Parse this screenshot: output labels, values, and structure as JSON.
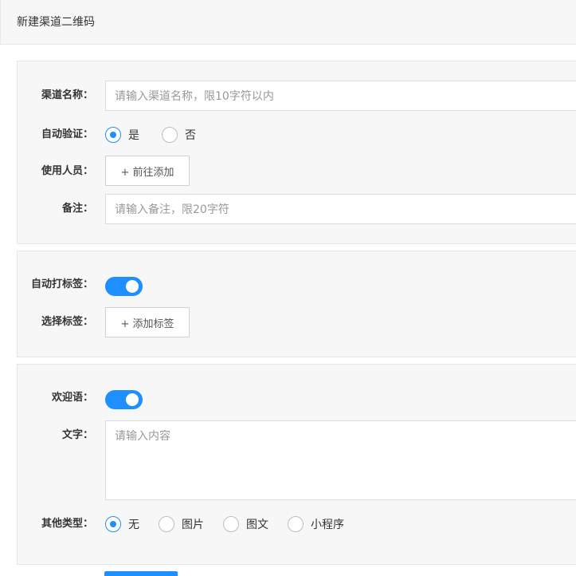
{
  "header": {
    "title": "新建渠道二维码"
  },
  "channel": {
    "name_label": "渠道名称：",
    "name_placeholder": "请输入渠道名称，限10字符以内",
    "auto_verify_label": "自动验证：",
    "auto_verify_options": [
      "是",
      "否"
    ],
    "auto_verify_selected": "是",
    "users_label": "使用人员：",
    "users_button": "+ 前往添加",
    "remark_label": "备注：",
    "remark_placeholder": "请输入备注，限20字符"
  },
  "tags": {
    "auto_tag_label": "自动打标签：",
    "auto_tag_on": true,
    "select_label": "选择标签：",
    "add_button": "+ 添加标签"
  },
  "welcome": {
    "label": "欢迎语：",
    "enabled": true,
    "text_label": "文字：",
    "text_placeholder": "请输入内容",
    "other_label": "其他类型：",
    "other_options": [
      "无",
      "图片",
      "图文",
      "小程序"
    ],
    "other_selected": "无"
  },
  "colors": {
    "accent": "#1e8fff",
    "panel_bg": "#f7f7f7"
  }
}
